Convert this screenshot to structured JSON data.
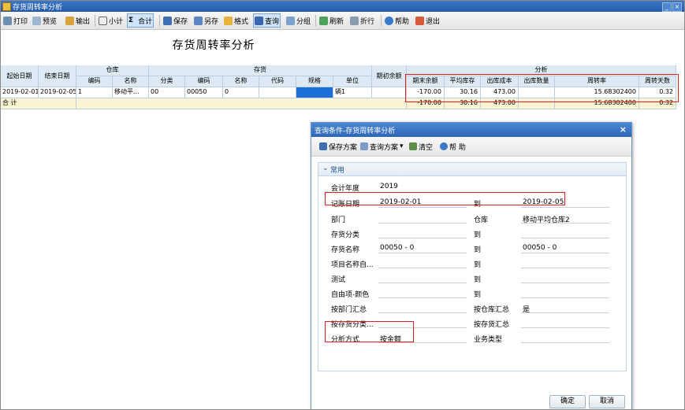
{
  "window": {
    "title": "存货周转率分析"
  },
  "toolbar": {
    "print": "打印",
    "preview": "预览",
    "export": "输出",
    "subtotal": "小计",
    "sigma": "Σ",
    "total": "合计",
    "save": "保存",
    "save_as": "另存",
    "format": "格式",
    "query": "查询",
    "group": "分组",
    "refresh": "刷新",
    "fold": "折行",
    "help": "帮助",
    "exit": "退出"
  },
  "report": {
    "title": "存货周转率分析",
    "headers": {
      "start_date": "起始日期",
      "end_date": "结束日期",
      "warehouse": "仓库",
      "inventory": "存货",
      "analysis": "分析",
      "wh_code": "编码",
      "wh_name": "名称",
      "inv_category": "分类",
      "inv_code": "编码",
      "inv_name": "名称",
      "inv_code2": "代码",
      "spec": "规格",
      "unit": "单位",
      "opening_balance": "期初余额",
      "closing_balance": "期末余额",
      "avg_inventory": "平均库存",
      "outbound_cost": "出库成本",
      "outbound_qty": "出库数量",
      "turnover_rate": "周转率",
      "turnover_days": "周转天数"
    },
    "row": {
      "start_date": "2019-02-01",
      "end_date": "2019-02-05",
      "wh_code": "1",
      "wh_name": "移动平...",
      "inv_category": "00",
      "inv_code": "00050",
      "inv_name": "0",
      "unit": "辆1",
      "closing_balance": "-170.00",
      "avg_inventory": "30.16",
      "outbound_cost": "473.00",
      "turnover_rate": "15.68302400",
      "turnover_days": "0.32"
    },
    "total": {
      "label": "合  计",
      "closing_balance": "-170.00",
      "avg_inventory": "30.16",
      "outbound_cost": "473.00",
      "turnover_rate": "15.68302400",
      "turnover_days": "0.32"
    }
  },
  "dialog": {
    "title": "查询条件-存货周转率分析",
    "tools": {
      "save_scheme": "保存方案",
      "query_scheme": "查询方案",
      "clear": "清空",
      "help": "帮 助"
    },
    "section": "常用",
    "fields": {
      "fiscal_year_label": "会计年度",
      "fiscal_year": "2019",
      "record_date_label": "记账日期",
      "record_date_from": "2019-02-01",
      "to": "到",
      "record_date_to": "2019-02-05",
      "department_label": "部门",
      "warehouse_label": "仓库",
      "warehouse": "移动平均仓库2",
      "inv_category_label": "存货分类",
      "inv_name_label": "存货名称",
      "inv_name_from": "00050 - 0",
      "inv_name_to": "00050 - 0",
      "item_name_label": "项目名称自...",
      "test_label": "测试",
      "custom_color_label": "自由项-颜色",
      "by_dept_label": "按部门汇总",
      "by_wh_label": "按仓库汇总",
      "by_wh": "是",
      "by_inv_cat_label": "按存货分类...",
      "by_inv_label": "按存货汇总",
      "method_label": "分析方式",
      "method": "按金额",
      "biz_type_label": "业务类型"
    },
    "ok": "确定",
    "cancel": "取消"
  }
}
